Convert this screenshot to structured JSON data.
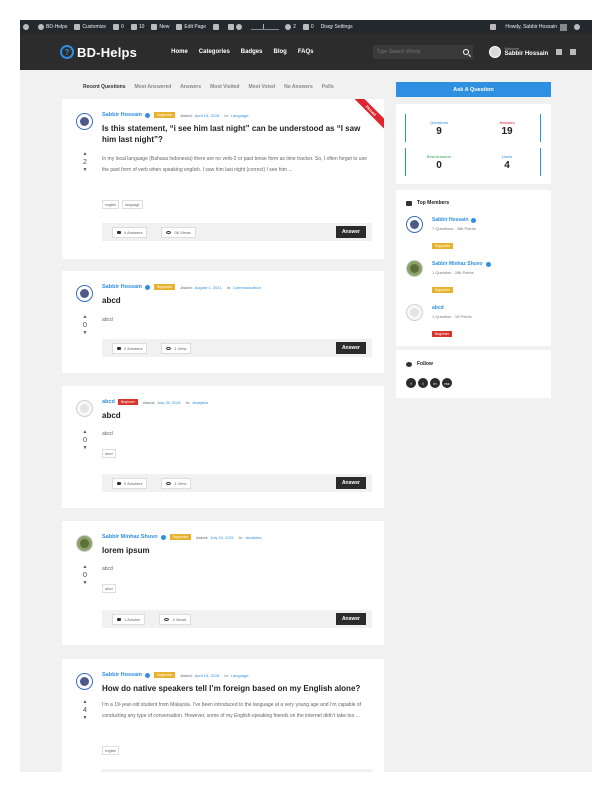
{
  "adminbar": {
    "site": "BD-Helps",
    "customize": "Customize",
    "comments": "0",
    "updates": "10",
    "new": "New",
    "edit_page": "Edit Page",
    "notifications": "2",
    "cart": "0",
    "settings": "Disqy Settings",
    "howdy": "Howdy, Sabbir Hossain"
  },
  "header": {
    "logo": "BD-Helps",
    "nav": [
      "Home",
      "Categories",
      "Badges",
      "Blog",
      "FAQs"
    ],
    "search_placeholder": "Type Search Words",
    "welcome_small": "Welcome",
    "welcome_name": "Sabbir Hossain"
  },
  "tabs": [
    "Recent Questions",
    "Most Answered",
    "Answers",
    "Most Visited",
    "Most Voted",
    "No Answers",
    "Polls"
  ],
  "questions": [
    {
      "author": "Sabbir Hossain",
      "badge": "Supporter",
      "asked": "Asked:",
      "date": "April 19, 2018",
      "in": "In:",
      "category": "Language",
      "title": "Is this statement, “i see him last night” can be understood as “I saw him last night”?",
      "votes": "2",
      "body": "In my local language (Bahasa Indonesia) there are no verb-2 or past tense form as time tracker. So, I often forget to use the past form of verb when speaking english. I saw him last night (correct) I see him ...",
      "tags": [
        "english",
        "language"
      ],
      "answers": "4 Answers",
      "views": "38 Views",
      "answer_label": "Answer",
      "pinned": "Pinned"
    },
    {
      "author": "Sabbir Hossain",
      "badge": "Supporter",
      "asked": "Asked:",
      "date": "August 1, 2021",
      "in": "In:",
      "category": "Communication",
      "title": "abcd",
      "votes": "0",
      "body": "abcd",
      "tags": [],
      "answers": "0 Answers",
      "views": "1 View",
      "answer_label": "Answer"
    },
    {
      "author": "abcd",
      "badge": "Beginner",
      "asked": "Asked:",
      "date": "July 25, 2021",
      "in": "In:",
      "category": "Analytics",
      "title": "abcd",
      "votes": "0",
      "body": "abcd",
      "tags": [
        "abcd"
      ],
      "answers": "0 Answers",
      "views": "1 View",
      "answer_label": "Answer"
    },
    {
      "author": "Sabbir Minhaz Shuvo",
      "badge": "Supporter",
      "asked": "Asked:",
      "date": "July 24, 2021",
      "in": "In:",
      "category": "Analytics",
      "title": "lorem ipsum",
      "votes": "0",
      "body": "abcd",
      "tags": [
        "abcd"
      ],
      "answers": "1 Answer",
      "views": "4 Views",
      "answer_label": "Answer"
    },
    {
      "author": "Sabbir Hossain",
      "badge": "Supporter",
      "asked": "Asked:",
      "date": "April 19, 2018",
      "in": "In:",
      "category": "Language",
      "title": "How do native speakers tell I’m foreign based on my English alone?",
      "votes": "4",
      "body": "I’m a 19-year-old student from Malaysia. I’ve been introduced to the language at a very young age and I’m capable of conducting any type of conversation. However, some of my English-speaking friends on the internet didn’t take too ...",
      "tags": [
        "english"
      ]
    }
  ],
  "sidebar": {
    "ask_button": "Ask A Question",
    "stats": [
      {
        "label": "Questions",
        "value": "9",
        "color": "#2f8fe0"
      },
      {
        "label": "Answers",
        "value": "19",
        "color": "#e0232c"
      },
      {
        "label": "Best Answers",
        "value": "0",
        "color": "#2ea44f"
      },
      {
        "label": "Users",
        "value": "4",
        "color": "#2f8fe0"
      }
    ],
    "top_members_title": "Top Members",
    "members": [
      {
        "name": "Sabbir Hossain",
        "info": "7 Questions · 28k Points",
        "badge": "Supporter"
      },
      {
        "name": "Sabbir Minhaz Shuvo",
        "info": "1 Question · 28k Points",
        "badge": "Supporter"
      },
      {
        "name": "abcd",
        "info": "1 Question · 19 Points",
        "badge": "Beginner"
      }
    ],
    "follow_title": "Follow",
    "socials": [
      "f",
      "t",
      "in",
      "rss"
    ]
  }
}
